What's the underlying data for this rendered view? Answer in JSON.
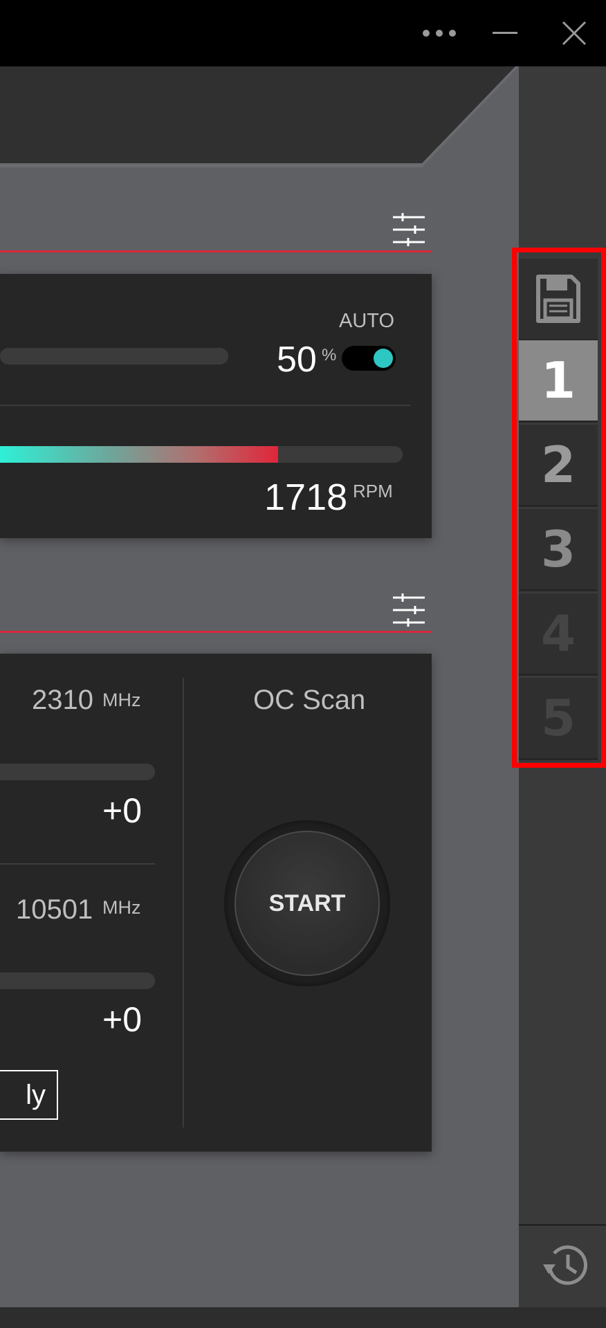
{
  "window": {
    "more_icon": "more-horizontal-icon",
    "minimize_icon": "minimize-icon",
    "close_icon": "close-icon"
  },
  "fan": {
    "mode_label": "AUTO",
    "speed_value": "50",
    "speed_unit": "%",
    "auto_enabled": true,
    "rpm_value": "1718",
    "rpm_unit": "RPM",
    "rpm_fill_fraction": 0.69
  },
  "oc": {
    "core_clock_value": "2310",
    "core_clock_unit": "MHz",
    "core_offset": "+0",
    "memory_clock_value": "10501",
    "memory_clock_unit": "MHz",
    "memory_offset": "+0",
    "apply_label": "ly",
    "scan_title": "OC Scan",
    "start_label": "START"
  },
  "profiles": {
    "save_icon": "floppy-disk-icon",
    "items": [
      {
        "label": "1",
        "active": true,
        "color": "#ffffff"
      },
      {
        "label": "2",
        "active": false,
        "color": "#9a9a9a"
      },
      {
        "label": "3",
        "active": false,
        "color": "#8a8a8a"
      },
      {
        "label": "4",
        "active": false,
        "color": "#454545"
      },
      {
        "label": "5",
        "active": false,
        "color": "#454545"
      }
    ]
  },
  "history_icon": "history-clock-icon",
  "colors": {
    "accent_red": "#d8283a",
    "toggle_teal": "#2dc6c3",
    "highlight": "#ff0000"
  }
}
